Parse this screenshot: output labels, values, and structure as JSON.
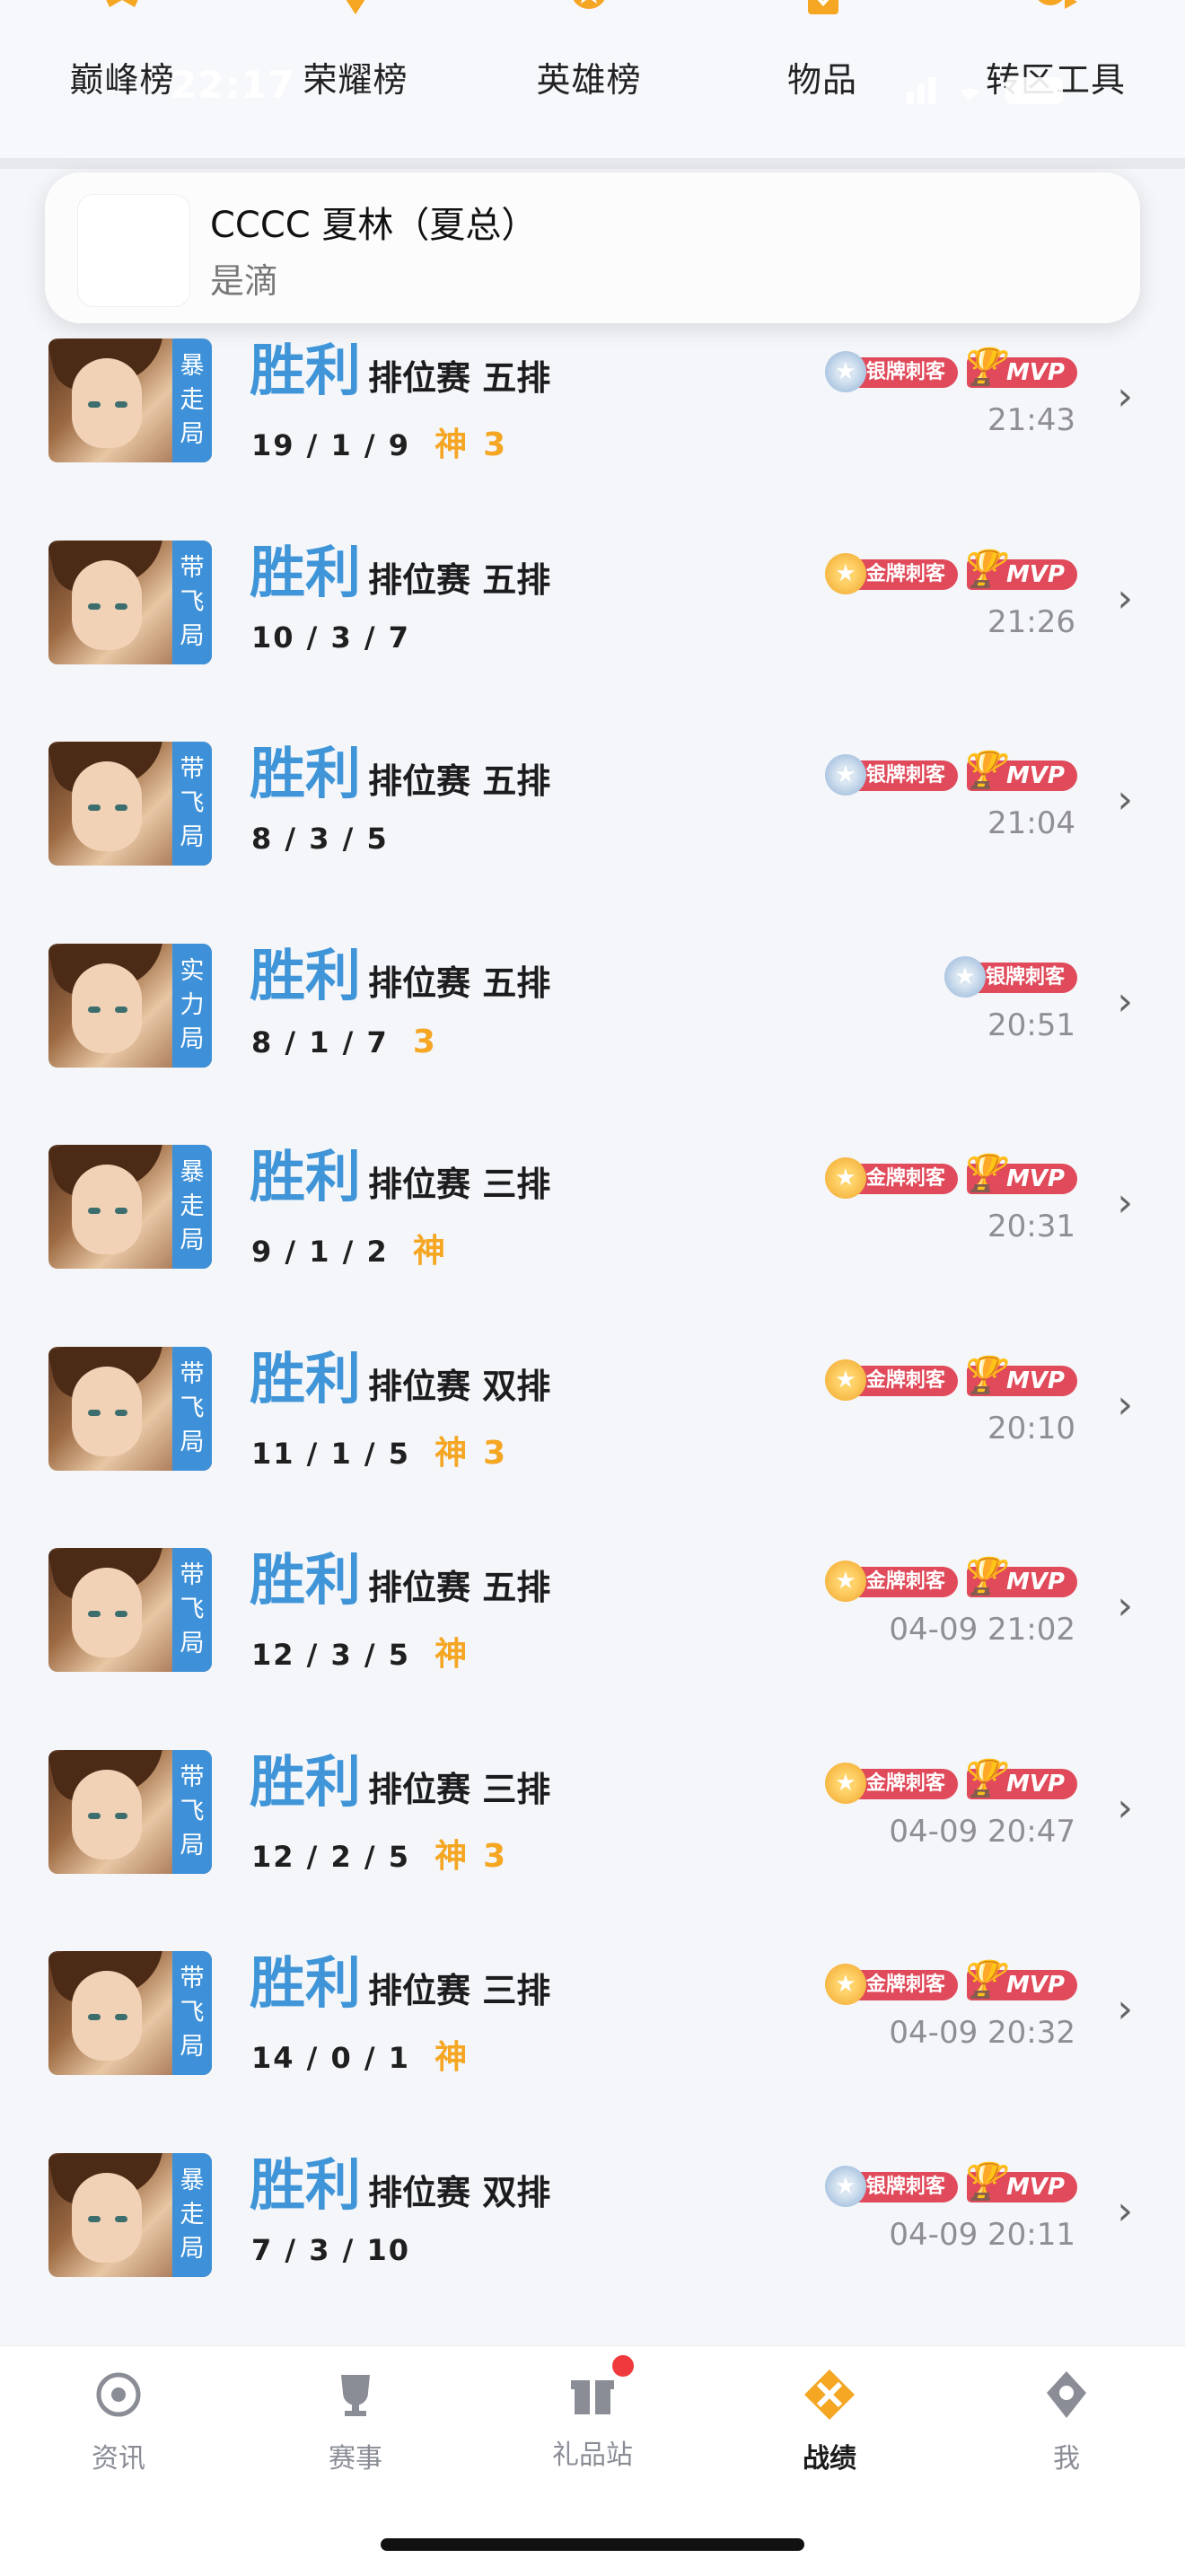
{
  "status_bar": {
    "time": "22:17"
  },
  "top_tools": [
    {
      "label": "巅峰榜",
      "icon": "peak-rank-icon"
    },
    {
      "label": "荣耀榜",
      "icon": "glory-rank-icon"
    },
    {
      "label": "英雄榜",
      "icon": "hero-rank-icon"
    },
    {
      "label": "物品",
      "icon": "items-icon"
    },
    {
      "label": "转区工具",
      "icon": "transfer-tool-icon"
    }
  ],
  "notification": {
    "title": "CCCC 夏林（夏总）",
    "subtitle": "是滴"
  },
  "matches": [
    {
      "tag": [
        "暴",
        "走",
        "局"
      ],
      "result": "胜利",
      "mode": "排位赛 五排",
      "kda": "19 / 1 / 9",
      "kda_badges": [
        "神",
        "3"
      ],
      "badges": [
        "银牌刺客",
        "MVP"
      ],
      "time": "21:43"
    },
    {
      "tag": [
        "带",
        "飞",
        "局"
      ],
      "result": "胜利",
      "mode": "排位赛 五排",
      "kda": "10 / 3 / 7",
      "kda_badges": [],
      "badges": [
        "金牌刺客",
        "MVP"
      ],
      "time": "21:26"
    },
    {
      "tag": [
        "带",
        "飞",
        "局"
      ],
      "result": "胜利",
      "mode": "排位赛 五排",
      "kda": "8 / 3 / 5",
      "kda_badges": [],
      "badges": [
        "银牌刺客",
        "MVP"
      ],
      "time": "21:04"
    },
    {
      "tag": [
        "实",
        "力",
        "局"
      ],
      "result": "胜利",
      "mode": "排位赛 五排",
      "kda": "8 / 1 / 7",
      "kda_badges": [
        "3"
      ],
      "badges": [
        "银牌刺客"
      ],
      "time": "20:51"
    },
    {
      "tag": [
        "暴",
        "走",
        "局"
      ],
      "result": "胜利",
      "mode": "排位赛 三排",
      "kda": "9 / 1 / 2",
      "kda_badges": [
        "神"
      ],
      "badges": [
        "金牌刺客",
        "MVP"
      ],
      "time": "20:31"
    },
    {
      "tag": [
        "带",
        "飞",
        "局"
      ],
      "result": "胜利",
      "mode": "排位赛 双排",
      "kda": "11 / 1 / 5",
      "kda_badges": [
        "神",
        "3"
      ],
      "badges": [
        "金牌刺客",
        "MVP"
      ],
      "time": "20:10"
    },
    {
      "tag": [
        "带",
        "飞",
        "局"
      ],
      "result": "胜利",
      "mode": "排位赛 五排",
      "kda": "12 / 3 / 5",
      "kda_badges": [
        "神"
      ],
      "badges": [
        "金牌刺客",
        "MVP"
      ],
      "time": "04-09 21:02"
    },
    {
      "tag": [
        "带",
        "飞",
        "局"
      ],
      "result": "胜利",
      "mode": "排位赛 三排",
      "kda": "12 / 2 / 5",
      "kda_badges": [
        "神",
        "3"
      ],
      "badges": [
        "金牌刺客",
        "MVP"
      ],
      "time": "04-09 20:47"
    },
    {
      "tag": [
        "带",
        "飞",
        "局"
      ],
      "result": "胜利",
      "mode": "排位赛 三排",
      "kda": "14 / 0 / 1",
      "kda_badges": [
        "神"
      ],
      "badges": [
        "金牌刺客",
        "MVP"
      ],
      "time": "04-09 20:32"
    },
    {
      "tag": [
        "暴",
        "走",
        "局"
      ],
      "result": "胜利",
      "mode": "排位赛 双排",
      "kda": "7 / 3 / 10",
      "kda_badges": [],
      "badges": [
        "银牌刺客",
        "MVP"
      ],
      "time": "04-09 20:11"
    }
  ],
  "tabbar": [
    {
      "label": "资讯",
      "icon": "news-icon",
      "active": false
    },
    {
      "label": "赛事",
      "icon": "trophy-icon",
      "active": false
    },
    {
      "label": "礼品站",
      "icon": "gift-icon",
      "active": false,
      "has_dot": true
    },
    {
      "label": "战绩",
      "icon": "battle-record-icon",
      "active": true
    },
    {
      "label": "我",
      "icon": "profile-icon",
      "active": false
    }
  ],
  "colors": {
    "accent_blue": "#3f95d7",
    "badge_red": "#e04a5a",
    "gold": "#f5a623",
    "active_tab": "#f5a623"
  }
}
